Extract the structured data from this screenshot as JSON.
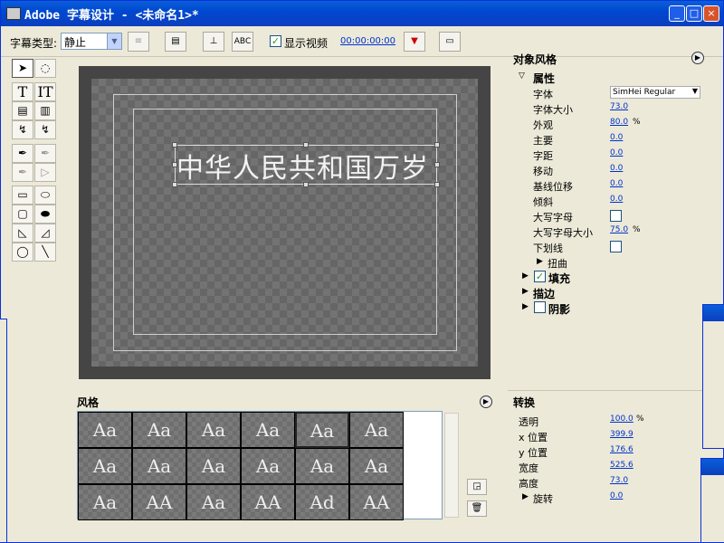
{
  "window": {
    "title": "Adobe 字幕设计 - <未命名1>*",
    "minimize": "_",
    "maximize": "□",
    "close": "×"
  },
  "toolbar": {
    "title_type_label": "字幕类型:",
    "title_type_value": "静止",
    "show_video_label": "显示视频",
    "timecode": "00:00:00:00",
    "text_tool_label": "ABC"
  },
  "canvas": {
    "title_text": "中华人民共和国万岁"
  },
  "object_style": {
    "header": "对象风格",
    "properties_label": "属性",
    "rows": [
      {
        "label": "字体",
        "value": "SimHei Regular",
        "type": "select"
      },
      {
        "label": "字体大小",
        "value": "73.0"
      },
      {
        "label": "外观",
        "value": "80.0",
        "unit": "%"
      },
      {
        "label": "主要",
        "value": "0.0"
      },
      {
        "label": "字距",
        "value": "0.0"
      },
      {
        "label": "移动",
        "value": "0.0"
      },
      {
        "label": "基线位移",
        "value": "0.0"
      },
      {
        "label": "倾斜",
        "value": "0.0"
      },
      {
        "label": "大写字母",
        "type": "checkbox",
        "checked": false
      },
      {
        "label": "大写字母大小",
        "value": "75.0",
        "unit": "%"
      },
      {
        "label": "下划线",
        "type": "checkbox",
        "checked": false
      },
      {
        "label": "扭曲",
        "type": "collapsed"
      }
    ],
    "fill_label": "填充",
    "fill_checked": true,
    "stroke_label": "描边",
    "shadow_label": "阴影",
    "shadow_checked": false
  },
  "styles": {
    "header": "风格",
    "swatches": [
      "Aa",
      "Aa",
      "Aa",
      "Aa",
      "Aa",
      "Aa",
      "Aa",
      "Aa",
      "Aa",
      "Aa",
      "Aa",
      "Aa",
      "Aa",
      "AA",
      "Aa",
      "AA",
      "Ad",
      "AA"
    ]
  },
  "transform": {
    "header": "转换",
    "rows": [
      {
        "label": "透明",
        "value": "100.0",
        "unit": "%"
      },
      {
        "label": "x 位置",
        "value": "399.9"
      },
      {
        "label": "y 位置",
        "value": "176.6"
      },
      {
        "label": "宽度",
        "value": "525.6"
      },
      {
        "label": "高度",
        "value": "73.0"
      },
      {
        "label": "旋转",
        "value": "0.0",
        "type": "collapsed"
      }
    ]
  }
}
